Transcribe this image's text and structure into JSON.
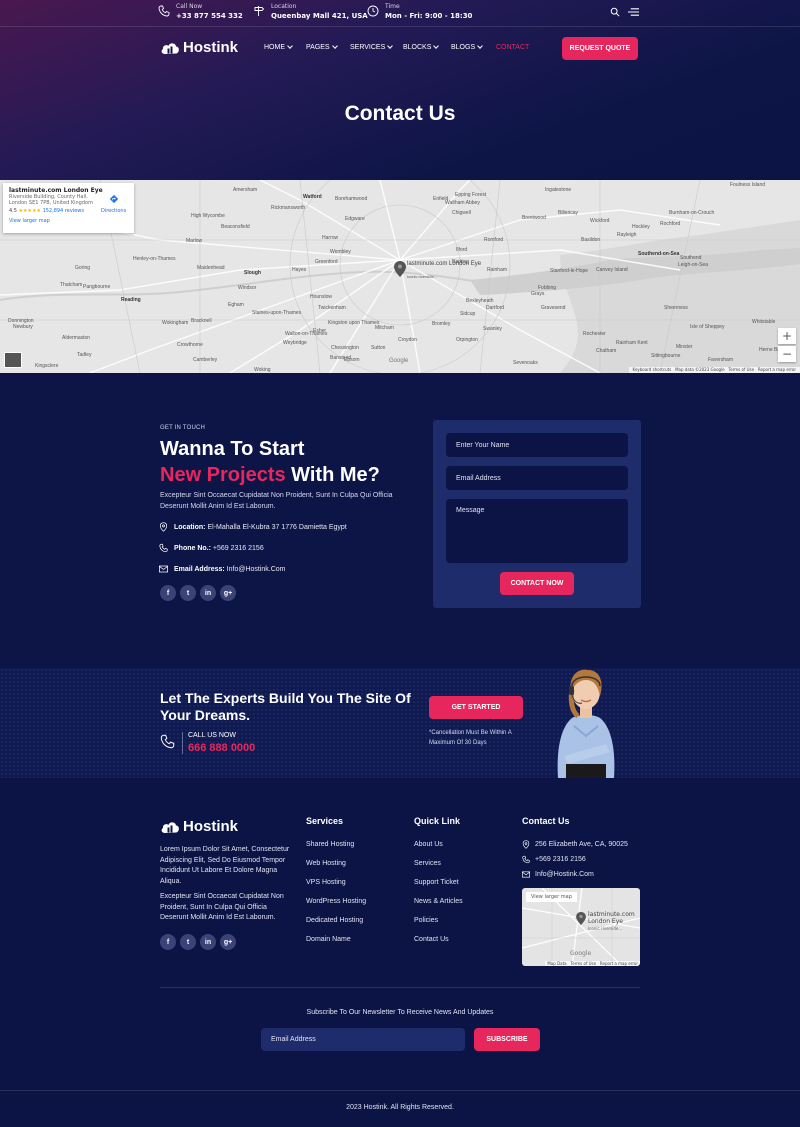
{
  "topbar": {
    "call": {
      "label": "Call Now",
      "value": "+33 877 554 332"
    },
    "location": {
      "label": "Location",
      "value": "Queenbay Mall 421, USA"
    },
    "time": {
      "label": "Time",
      "value": "Mon - Fri: 9:00 - 18:30"
    }
  },
  "brand": {
    "name": "Hostink"
  },
  "nav": {
    "items": [
      {
        "label": "HOME",
        "dropdown": true
      },
      {
        "label": "PAGES",
        "dropdown": true
      },
      {
        "label": "SERVICES",
        "dropdown": true
      },
      {
        "label": "BLOCKS",
        "dropdown": true
      },
      {
        "label": "BLOGS",
        "dropdown": true
      },
      {
        "label": "CONTACT",
        "dropdown": false,
        "active": true
      }
    ],
    "cta": "REQUEST QUOTE"
  },
  "page": {
    "title": "Contact Us"
  },
  "map": {
    "card_title": "lastminute.com London Eye",
    "card_address": "Riverside Building, County Hall, London SE1 7PB, United Kingdom",
    "card_rating": "4.5",
    "card_stars": "★★★★★",
    "card_reviews": "152,894 reviews",
    "card_directions": "Directions",
    "card_larger": "View larger map",
    "pin_label": "lastminute.com London Eye",
    "pin_sub": "Iconic riverside...",
    "attribution": "Keyboard shortcuts   Map data ©2023 Google   Terms of Use   Report a map error",
    "google": "Google",
    "zoom_in": "+",
    "zoom_out": "−",
    "places": [
      "Amersham",
      "Watford",
      "Borehamwood",
      "Enfield",
      "Waltham Abbey",
      "Epping Forest",
      "Ingatestone",
      "Billericay",
      "Wickford",
      "Rochford",
      "Southend-on-Sea",
      "Basildon",
      "Brentwood",
      "Romford",
      "Ilford",
      "Barking",
      "Rainham",
      "Grays",
      "Gravesend",
      "Stanford-le-Hope",
      "Canvey Island",
      "Harrow",
      "Wembley",
      "Greenford",
      "Hayes",
      "Slough",
      "Windsor",
      "Staines-upon-Thames",
      "Hounslow",
      "Twickenham",
      "Kingston upon Thames",
      "Epsom",
      "Croydon",
      "Mitcham",
      "Bromley",
      "Orpington",
      "Sidcup",
      "Swanley",
      "Dartford",
      "Bexleyheath",
      "Maidenhead",
      "Bracknell",
      "Wokingham",
      "Reading",
      "Henley-on-Thames",
      "Marlow",
      "High Wycombe",
      "Beaconsfield",
      "Rickmansworth",
      "Edgware",
      "Chigwell",
      "Sevenoaks",
      "Chatham",
      "Rochester",
      "Sheerness",
      "Sittingbourne",
      "Crowthorne",
      "Camberley",
      "Woking",
      "Weybridge",
      "Esher",
      "Sutton",
      "Banstead",
      "Chessington",
      "Walton-on-Thames",
      "Egham",
      "Thatcham",
      "Newbury",
      "Pangbourne",
      "Donnington",
      "Goring",
      "Tadley",
      "Kingsclere",
      "Aldermaston",
      "Southend",
      "Leigh-on-Sea",
      "Hockley",
      "Rayleigh",
      "Fobbing",
      "Foulness Island",
      "Burnham-on-Crouch",
      "Whitstable",
      "Herne Bay",
      "Faversham",
      "Isle of Sheppey",
      "Minster",
      "Rainham Kent"
    ]
  },
  "contact": {
    "eyebrow": "GET IN TOUCH",
    "heading_line1": "Wanna To Start",
    "heading_pink": "New Projects",
    "heading_rest": " With Me?",
    "description": "Excepteur Sint Occaecat Cupidatat Non Proident, Sunt In Culpa Qui Officia Deserunt Mollit Anim Id Est Laborum.",
    "location_label": "Location:",
    "location_value": "El-Mahalla El-Kubra 37 1776 Damietta Egypt",
    "phone_label": "Phone No.:",
    "phone_value": "+569 2316 2156",
    "email_label": "Email Address:",
    "email_value": "Info@Hostink.Com",
    "social": [
      "f",
      "t",
      "in",
      "g+"
    ]
  },
  "form": {
    "name_placeholder": "Enter Your Name",
    "email_placeholder": "Email Address",
    "message_placeholder": "Message",
    "submit": "CONTACT NOW"
  },
  "cta": {
    "title_line1": "Let The Experts Build You The Site Of",
    "title_line2": "Your Dreams.",
    "call_label": "CALL US NOW",
    "call_number": "666 888 0000",
    "button": "GET STARTED",
    "note_line1": "*Cancellation Must Be Within A",
    "note_line2": "Maximum Of 30 Days"
  },
  "footer": {
    "desc1": "Lorem Ipsum Dolor Sit Amet, Consectetur Adipiscing Elit, Sed Do Eiusmod Tempor Incididunt Ut Labore Et Dolore Magna Aliqua.",
    "desc2": "Excepteur Sint Occaecat Cupidatat Non Proident, Sunt In Culpa Qui Officia Deserunt Mollit Anim Id Est Laborum.",
    "services_title": "Services",
    "services": [
      "Shared Hosting",
      "Web Hosting",
      "VPS Hosting",
      "WordPress Hosting",
      "Dedicated Hosting",
      "Domain Name"
    ],
    "quick_title": "Quick Link",
    "quick": [
      "About Us",
      "Services",
      "Support Ticket",
      "News & Articles",
      "Policies",
      "Contact Us"
    ],
    "contact_title": "Contact Us",
    "contact_address": "256 Elizabeth Ave, CA, 90025",
    "contact_phone": "+569 2316 2156",
    "contact_email": "Info@Hostink.Com",
    "mini_map_link": "View larger map",
    "mini_map_pin": "lastminute.com London Eye",
    "mini_map_pin_sub": "Iconic riverside...",
    "mini_map_attr": "Map Data   Terms of Use   Report a map error",
    "newsletter_text": "Subscribe To Our Newsletter To Receive News And Updates",
    "newsletter_placeholder": "Email Address",
    "newsletter_button": "SUBSCRIBE",
    "copyright": "2023 Hostink. All Rights Reserved."
  },
  "colors": {
    "accent": "#e8265e",
    "background": "#0b1445",
    "card": "#1f2c6b"
  }
}
